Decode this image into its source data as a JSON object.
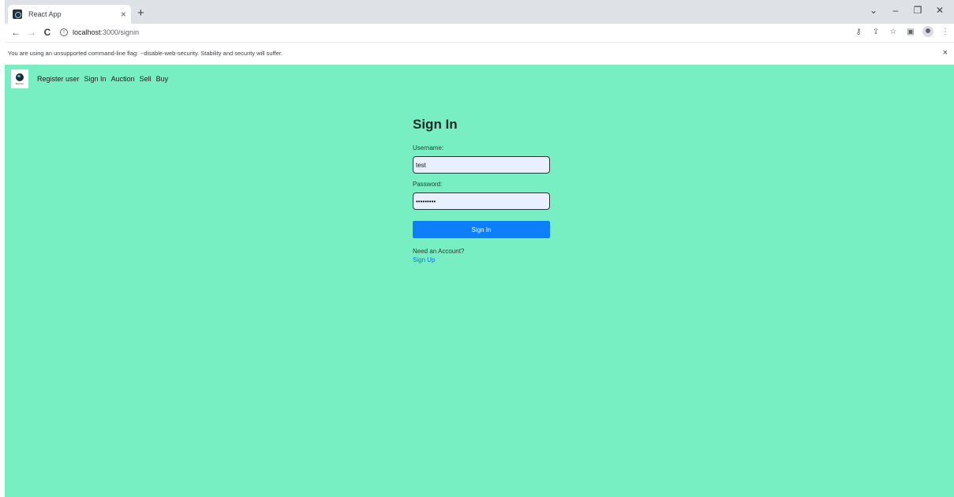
{
  "browser": {
    "tab_title": "React App",
    "tab_close": "×",
    "new_tab": "+",
    "window_controls": [
      "⌄",
      "–",
      "❐",
      "✕"
    ],
    "url_host": "localhost",
    "url_rest": ":3000/signin",
    "infobar_text": "You are using an unsupported command-line flag: --disable-web-security. Stability and security will suffer.",
    "infobar_close": "×",
    "toolbar_icons": [
      "key-icon",
      "share-icon",
      "star-icon",
      "sidepanel-icon",
      "profile-icon",
      "menu-icon"
    ]
  },
  "navbar": {
    "logo_text": "Explore",
    "links": [
      "Register user",
      "Sign In",
      "Auction",
      "Sell",
      "Buy"
    ]
  },
  "signin": {
    "title": "Sign In",
    "username_label": "Username:",
    "username_value": "test",
    "password_label": "Password:",
    "password_value": "•••••••••",
    "submit_label": "Sign In",
    "need_account": "Need an Account?",
    "signup_link": "Sign Up"
  },
  "colors": {
    "page_bg": "#78efc3",
    "button": "#0d7ffa",
    "link": "#0d6efd",
    "input_bg": "#e8f0fe"
  }
}
